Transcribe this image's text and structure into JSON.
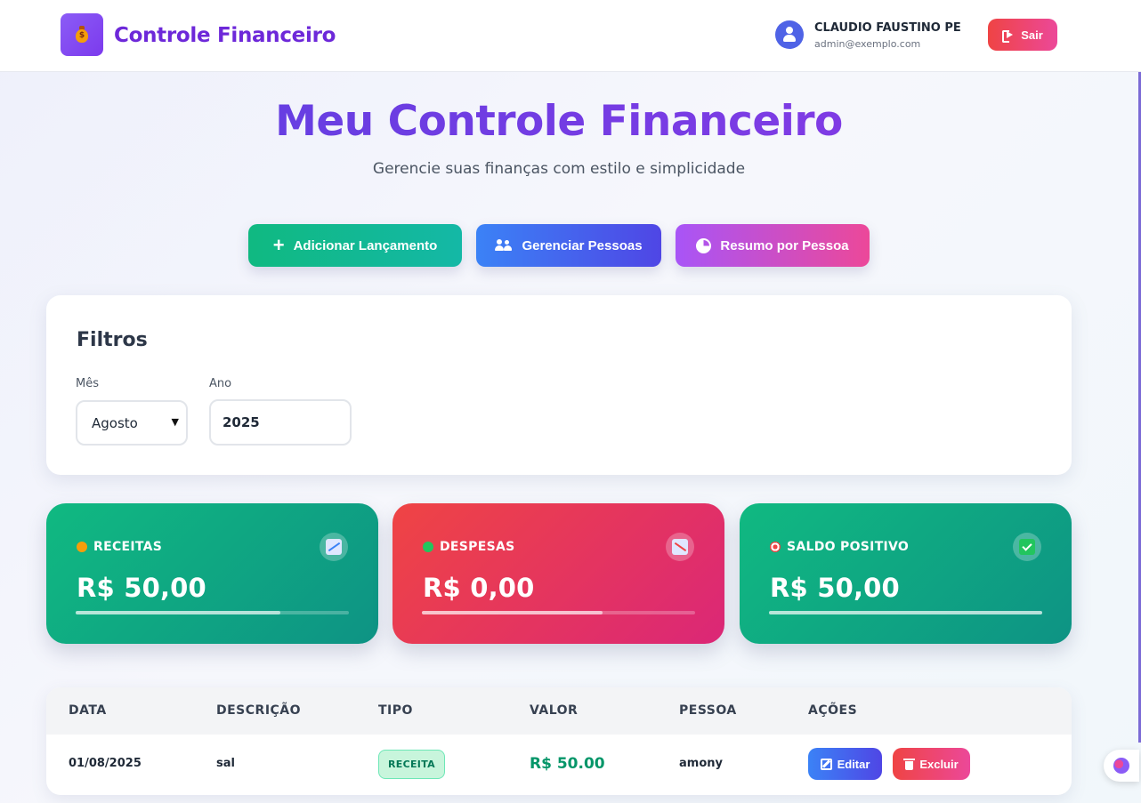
{
  "header": {
    "brand_icon": "money-bag-icon",
    "brand_symbol": "$",
    "title": "Controle Financeiro",
    "user_name": "CLAUDIO FAUSTINO PE...",
    "user_email": "admin@exemplo.com",
    "logout_label": "Sair"
  },
  "hero": {
    "title": "Meu Controle Financeiro",
    "subtitle": "Gerencie suas finanças com estilo e simplicidade"
  },
  "actions": {
    "add_label": "Adicionar Lançamento",
    "people_label": "Gerenciar Pessoas",
    "summary_label": "Resumo por Pessoa"
  },
  "filters": {
    "title": "Filtros",
    "month_label": "Mês",
    "month_value": "Agosto",
    "year_label": "Ano",
    "year_value": "2025"
  },
  "summary": {
    "income": {
      "label": "RECEITAS",
      "value": "R$ 50,00",
      "progress": 0.75,
      "icon": "chart-up-icon"
    },
    "expense": {
      "label": "DESPESAS",
      "value": "R$ 0,00",
      "progress": 0.66,
      "icon": "chart-down-icon"
    },
    "balance": {
      "label": "SALDO POSITIVO",
      "value": "R$ 50,00",
      "progress": 1.0,
      "icon": "check-icon"
    }
  },
  "table": {
    "headers": [
      "DATA",
      "DESCRIÇÃO",
      "TIPO",
      "VALOR",
      "PESSOA",
      "AÇÕES"
    ],
    "rows": [
      {
        "date": "01/08/2025",
        "description": "sal",
        "type": "RECEITA",
        "value": "R$ 50.00",
        "person": "amony",
        "edit_label": "Editar",
        "delete_label": "Excluir"
      }
    ]
  },
  "colors": {
    "brand": "#6d28d9",
    "income": "#10b981",
    "expense": "#ef4444",
    "primary_blue": "#3b82f6"
  }
}
